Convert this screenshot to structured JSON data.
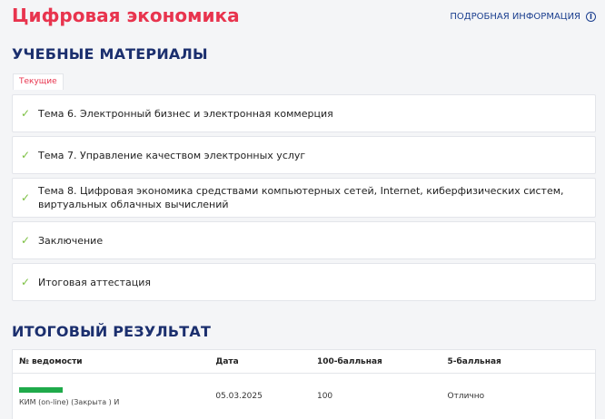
{
  "header": {
    "course_title": "Цифровая экономика",
    "more_info_label": "ПОДРОБНАЯ ИНФОРМАЦИЯ",
    "more_info_icon": "info-icon"
  },
  "materials": {
    "heading": "УЧЕБНЫЕ МАТЕРИАЛЫ",
    "tab_label": "Текущие",
    "check_glyph": "✓",
    "accent_color": "#7cc042",
    "topics": [
      {
        "label": "Тема 6. Электронный бизнес и электронная коммерция"
      },
      {
        "label": "Тема 7. Управление качеством электронных услуг"
      },
      {
        "label": "Тема 8. Цифровая экономика средствами компьютерных сетей, Internet, киберфизических систем, виртуальных облачных вычислений"
      },
      {
        "label": "Заключение"
      },
      {
        "label": "Итоговая аттестация"
      }
    ]
  },
  "result": {
    "heading": "ИТОГОВЫЙ РЕЗУЛЬТАТ",
    "columns": {
      "doc": "№ ведомости",
      "date": "Дата",
      "score100": "100-балльная",
      "score5": "5-балльная"
    },
    "rows": [
      {
        "doc_name": "КИМ (on-line) (Закрыта ) И",
        "progress": 1.0,
        "progress_color": "#1faa4a",
        "date": "05.03.2025",
        "score100": "100",
        "score5": "Отлично"
      }
    ]
  },
  "colors": {
    "title": "#e8344e",
    "heading": "#1b2f6e",
    "link": "#1b3f8f",
    "background": "#f4f5f7"
  }
}
